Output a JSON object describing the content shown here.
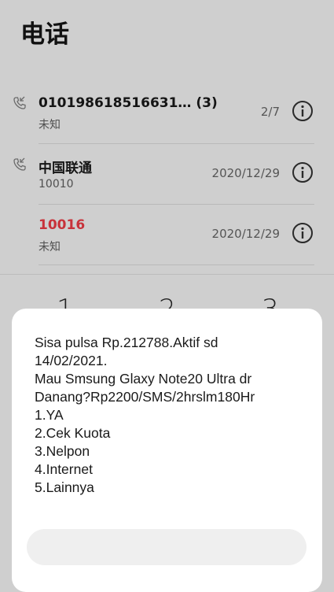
{
  "header": {
    "title": "电话"
  },
  "calls": [
    {
      "name": "010198618516631…  (3)",
      "sub": "未知",
      "meta": "2/7",
      "missed": false,
      "icon": "incoming-call-icon"
    },
    {
      "name": "中国联通",
      "sub": "10010",
      "meta": "2020/12/29",
      "missed": false,
      "icon": "incoming-call-icon"
    },
    {
      "name": "10016",
      "sub": "未知",
      "meta": "2020/12/29",
      "missed": true,
      "icon": null
    }
  ],
  "dialpad": {
    "keys": [
      "1",
      "2",
      "3"
    ]
  },
  "dialog": {
    "lines": [
      "Sisa pulsa Rp.212788.Aktif sd",
      "14/02/2021.",
      "Mau Smsung Glaxy Note20 Ultra dr",
      "Danang?Rp2200/SMS/2hrslm180Hr",
      "1.YA",
      "2.Cek Kuota",
      "3.Nelpon",
      "4.Internet",
      "5.Lainnya"
    ],
    "input_value": "",
    "input_placeholder": ""
  },
  "colors": {
    "missed": "#c8323a",
    "overlay_bg": "#cfcfcf",
    "dialog_bg": "#ffffff"
  }
}
